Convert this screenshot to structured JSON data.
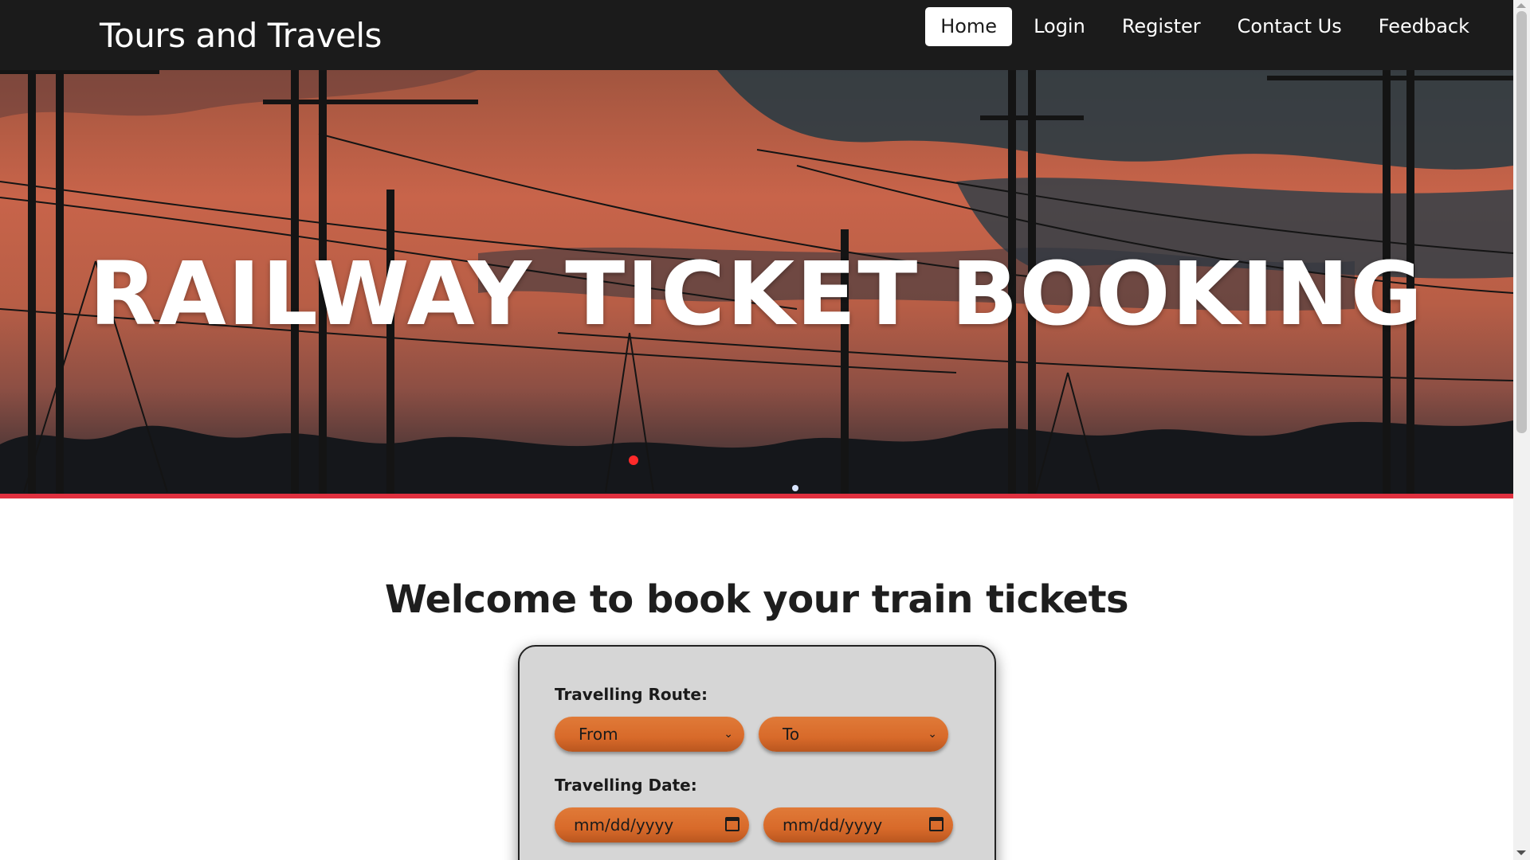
{
  "navbar": {
    "brand": "Tours and Travels",
    "links": [
      "Home",
      "Login",
      "Register",
      "Contact Us",
      "Feedback"
    ],
    "active": "Home"
  },
  "hero": {
    "title": "RAILWAY TICKET BOOKING",
    "accent_color": "#e0303f"
  },
  "main": {
    "welcome": "Welcome to book your train tickets"
  },
  "form": {
    "route_label": "Travelling Route:",
    "from_value": "From",
    "to_value": "To",
    "date_label": "Travelling Date:",
    "date_from_value": "mm/dd/yyyy",
    "date_to_value": "mm/dd/yyyy",
    "field_color": "#d86a2a"
  }
}
